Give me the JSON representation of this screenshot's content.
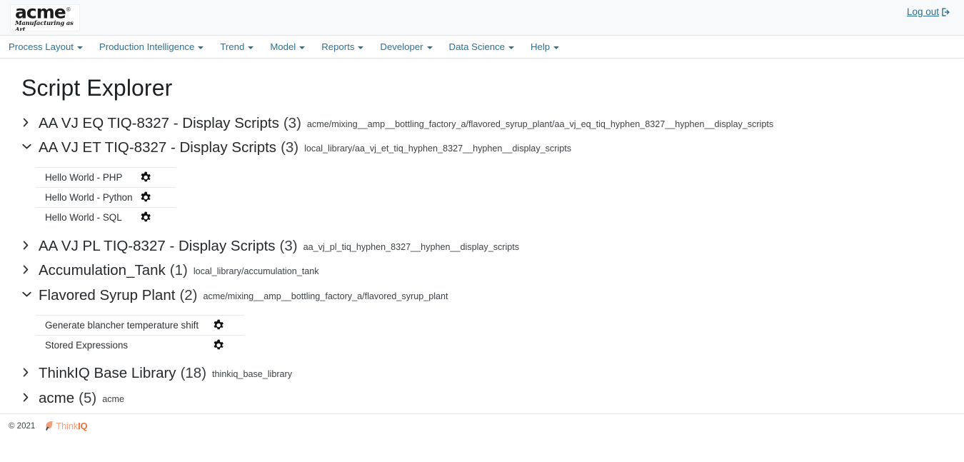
{
  "brand": {
    "logo_word": "acme",
    "logo_reg": "®",
    "logo_tagline": "Manufacturing as Art",
    "logout_label": "Log out",
    "logout_icon": "sign-out-icon",
    "accent_link_color": "#2a7292",
    "bar_background": "#f8f9fb"
  },
  "nav": {
    "items": [
      {
        "label": "Process Layout",
        "caret": "caret-down-icon"
      },
      {
        "label": "Production Intelligence",
        "caret": "caret-down-icon"
      },
      {
        "label": "Trend",
        "caret": "caret-down-icon"
      },
      {
        "label": "Model",
        "caret": "caret-down-icon"
      },
      {
        "label": "Reports",
        "caret": "caret-down-icon"
      },
      {
        "label": "Developer",
        "caret": "caret-down-icon"
      },
      {
        "label": "Data Science",
        "caret": "caret-down-icon"
      },
      {
        "label": "Help",
        "caret": "caret-down-icon"
      }
    ]
  },
  "page": {
    "title": "Script Explorer"
  },
  "tree": {
    "nodes": [
      {
        "title": "AA VJ EQ TIQ-8327 - Display Scripts",
        "count": "(3)",
        "path": "acme/mixing__amp__bottling_factory_a/flavored_syrup_plant/aa_vj_eq_tiq_hyphen_8327__hyphen__display_scripts",
        "expanded": false,
        "chevron": "chevron-right-icon",
        "children": []
      },
      {
        "title": "AA VJ ET TIQ-8327 - Display Scripts",
        "count": "(3)",
        "path": "local_library/aa_vj_et_tiq_hyphen_8327__hyphen__display_scripts",
        "expanded": true,
        "chevron": "chevron-down-icon",
        "children": [
          {
            "label": "Hello World - PHP",
            "gear": "gear-icon"
          },
          {
            "label": "Hello World - Python",
            "gear": "gear-icon"
          },
          {
            "label": "Hello World - SQL",
            "gear": "gear-icon"
          }
        ]
      },
      {
        "title": "AA VJ PL TIQ-8327 - Display Scripts",
        "count": "(3)",
        "path": "aa_vj_pl_tiq_hyphen_8327__hyphen__display_scripts",
        "expanded": false,
        "chevron": "chevron-right-icon",
        "children": []
      },
      {
        "title": "Accumulation_Tank",
        "count": "(1)",
        "path": "local_library/accumulation_tank",
        "expanded": false,
        "chevron": "chevron-right-icon",
        "children": []
      },
      {
        "title": "Flavored Syrup Plant",
        "count": "(2)",
        "path": "acme/mixing__amp__bottling_factory_a/flavored_syrup_plant",
        "expanded": true,
        "chevron": "chevron-down-icon",
        "children": [
          {
            "label": "Generate blancher temperature shift",
            "gear": "gear-icon"
          },
          {
            "label": "Stored Expressions",
            "gear": "gear-icon"
          }
        ]
      },
      {
        "title": "ThinkIQ Base Library",
        "count": "(18)",
        "path": "thinkiq_base_library",
        "expanded": false,
        "chevron": "chevron-right-icon",
        "children": []
      },
      {
        "title": "acme",
        "count": "(5)",
        "path": "acme",
        "expanded": false,
        "chevron": "chevron-right-icon",
        "children": []
      }
    ]
  },
  "footer": {
    "copyright": "© 2021",
    "brand_mark": "thinkiq-leaf-icon",
    "brand_text_light": "Think",
    "brand_text_bold": "IQ",
    "brand_color": "#ea7240"
  }
}
